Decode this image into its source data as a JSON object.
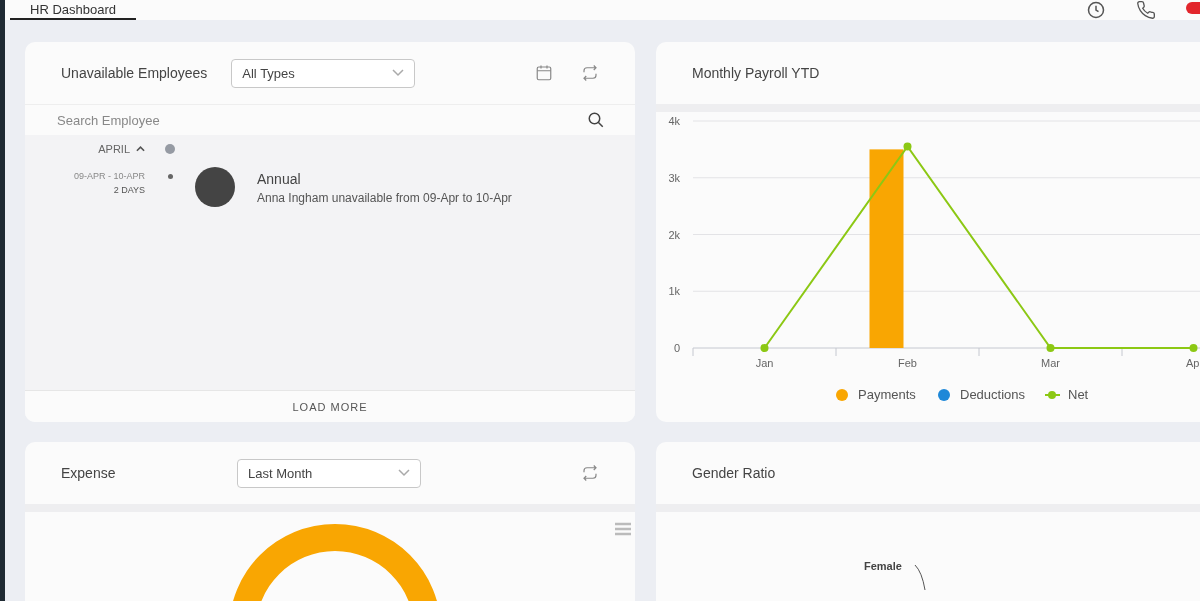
{
  "tabs": [
    {
      "label": "HR Dashboard",
      "selected": true
    }
  ],
  "unavailable": {
    "title": "Unavailable Employees",
    "filter": "All Types",
    "search_placeholder": "Search Employee",
    "month": "APRIL",
    "expanded": true,
    "entries": [
      {
        "dates": "09-APR - 10-APR",
        "duration": "2 DAYS",
        "type": "Annual",
        "description": "Anna Ingham unavailable from 09-Apr to 10-Apr"
      }
    ],
    "load_more": "LOAD MORE"
  },
  "payroll": {
    "title": "Monthly Payroll YTD",
    "chart_data": {
      "type": "bar",
      "categories": [
        "Jan",
        "Feb",
        "Mar",
        "Ap"
      ],
      "series": [
        {
          "name": "Payments",
          "color": "#f9a602",
          "type": "bar",
          "values": [
            0,
            3500,
            0,
            null
          ]
        },
        {
          "name": "Deductions",
          "color": "#1e88d8",
          "type": "bar",
          "values": [
            0,
            0,
            0,
            null
          ]
        },
        {
          "name": "Net",
          "color": "#8cc814",
          "type": "line",
          "marker": "circle",
          "values": [
            0,
            3550,
            0,
            0
          ]
        }
      ],
      "grid": true,
      "legend": "bottom",
      "ylim": [
        0,
        4000
      ],
      "yticks": [
        {
          "value": 0,
          "label": "0"
        },
        {
          "value": 1000,
          "label": "1k"
        },
        {
          "value": 2000,
          "label": "2k"
        },
        {
          "value": 3000,
          "label": "3k"
        },
        {
          "value": 4000,
          "label": "4k"
        }
      ]
    }
  },
  "expense": {
    "title": "Expense",
    "filter": "Last Month"
  },
  "gender": {
    "title": "Gender Ratio",
    "labels": [
      "Female"
    ]
  }
}
